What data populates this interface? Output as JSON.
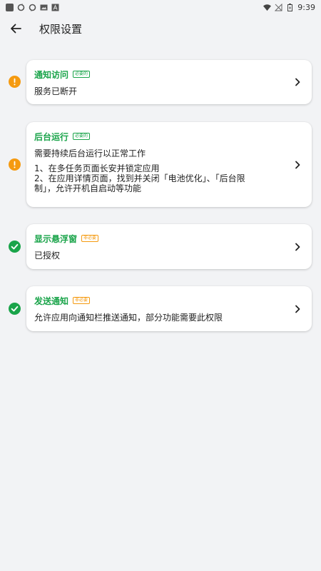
{
  "status_bar": {
    "time": "9:39"
  },
  "header": {
    "title": "权限设置"
  },
  "permissions": [
    {
      "title": "通知访问",
      "badge": "必要的",
      "badge_type": "required",
      "status": "warning",
      "description": "服务已断开"
    },
    {
      "title": "后台运行",
      "badge": "必要的",
      "badge_type": "required",
      "status": "warning",
      "description": "需要持续后台运行以正常工作",
      "steps": [
        "1、在多任务页面长安并锁定应用",
        "2、在应用详情页面，找到并关闭「电池优化」、「后台限",
        "制」，允许开机自启动等功能"
      ]
    },
    {
      "title": "显示悬浮窗",
      "badge": "非必要",
      "badge_type": "optional",
      "status": "ok",
      "description": "已授权"
    },
    {
      "title": "发送通知",
      "badge": "非必要",
      "badge_type": "optional",
      "status": "ok",
      "description": "允许应用向通知栏推送通知，部分功能需要此权限"
    }
  ],
  "colors": {
    "accent_green": "#1aa44a",
    "warning_orange": "#f59a10",
    "background": "#f2f3f5"
  }
}
